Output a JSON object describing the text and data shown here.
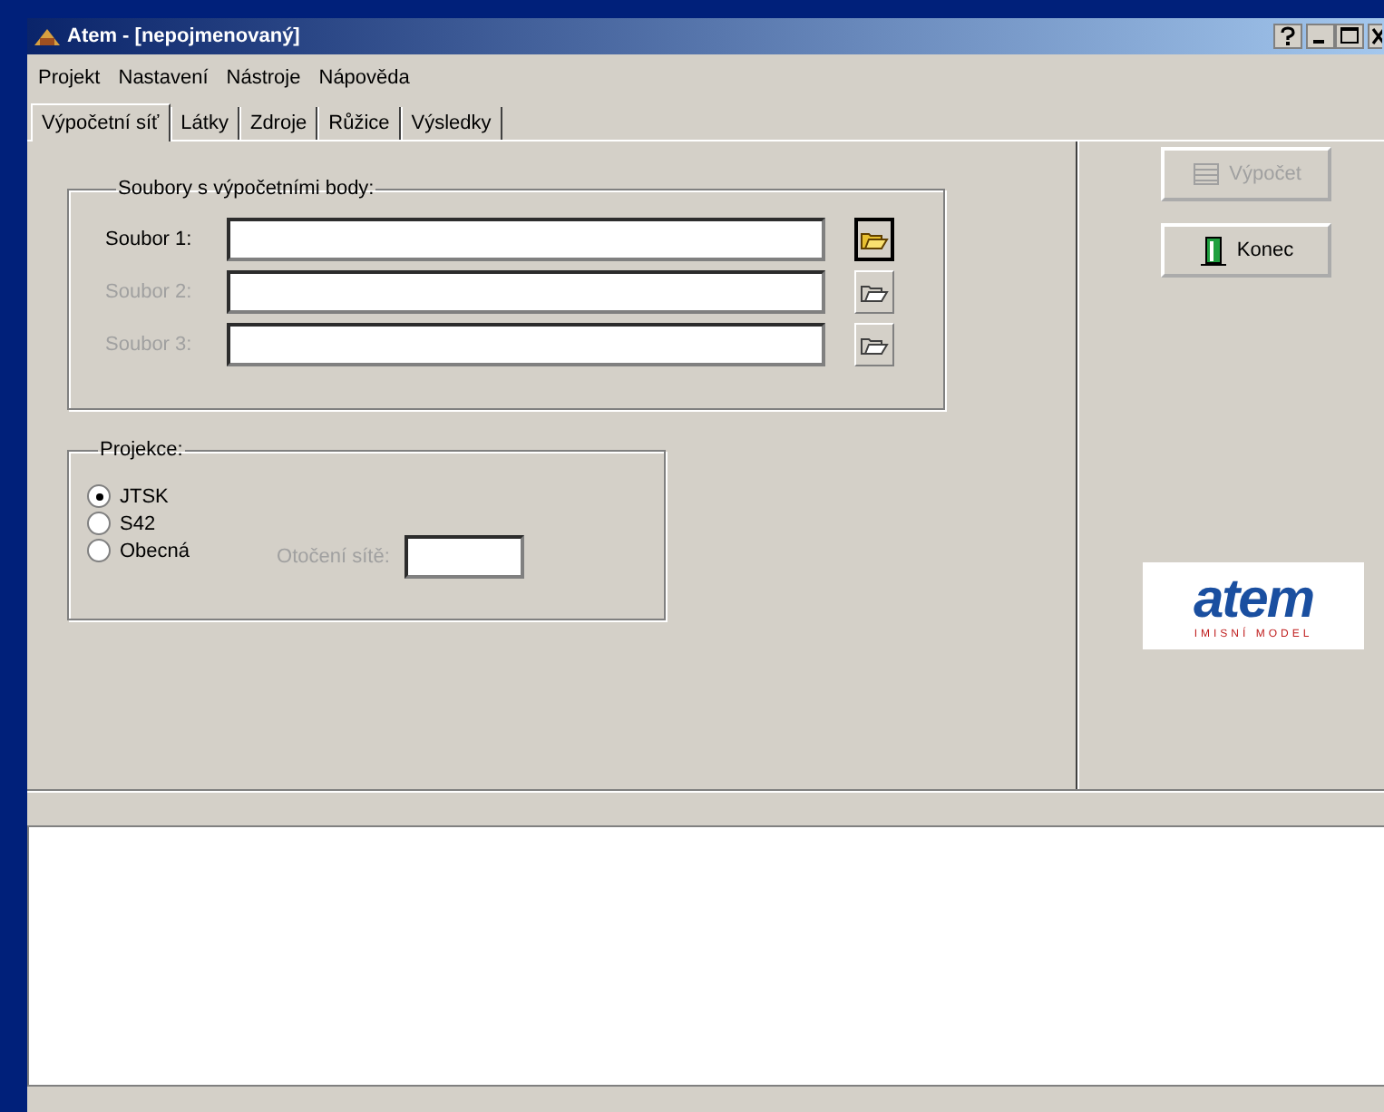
{
  "window": {
    "title": "Atem - [nepojmenovaný]"
  },
  "menu": [
    "Projekt",
    "Nastavení",
    "Nástroje",
    "Nápověda"
  ],
  "tabs": [
    {
      "label": "Výpočetní síť",
      "selected": true
    },
    {
      "label": "Látky",
      "selected": false
    },
    {
      "label": "Zdroje",
      "selected": false
    },
    {
      "label": "Růžice",
      "selected": false
    },
    {
      "label": "Výsledky",
      "selected": false
    }
  ],
  "files_group": {
    "title": "Soubory s výpočetními body:",
    "files": [
      {
        "label": "Soubor 1:",
        "disabled": false
      },
      {
        "label": "Soubor 2:",
        "disabled": true
      },
      {
        "label": "Soubor 3:",
        "disabled": true
      }
    ]
  },
  "projection_group": {
    "title": "Projekce:",
    "options": [
      {
        "label": "JTSK",
        "selected": true
      },
      {
        "label": "S42",
        "selected": false
      },
      {
        "label": "Obecná",
        "selected": false
      }
    ],
    "rotation": {
      "label": "Otočení sítě:",
      "disabled": true
    }
  },
  "buttons": [
    {
      "kind": "calc",
      "label": "Výpočet",
      "disabled": true
    },
    {
      "kind": "exit",
      "label": "Konec",
      "disabled": false
    }
  ],
  "logo": {
    "text": "atem",
    "subtitle": "IMISNÍ MODEL"
  }
}
